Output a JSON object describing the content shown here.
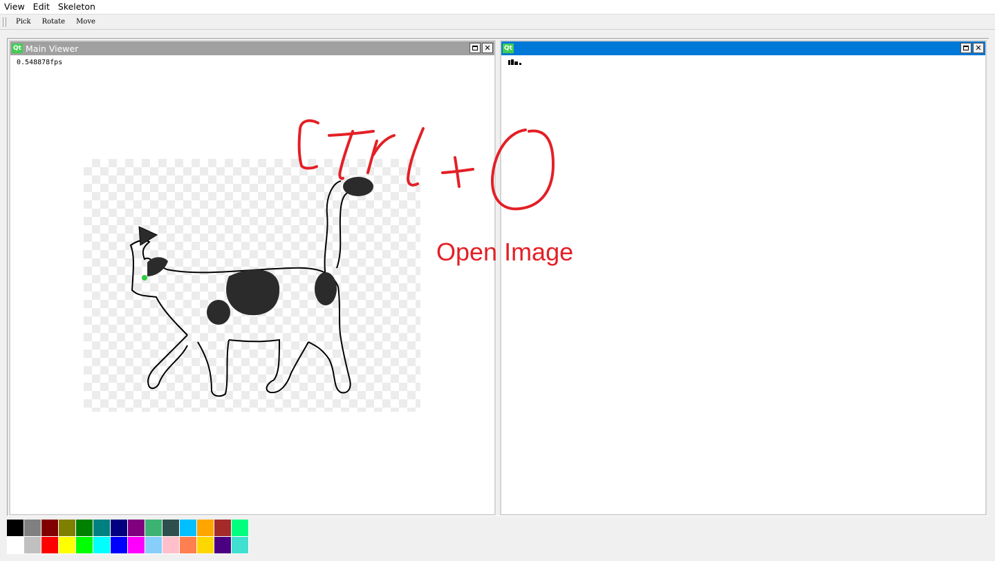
{
  "menubar": {
    "items": [
      "View",
      "Edit",
      "Skeleton"
    ]
  },
  "toolbar": {
    "items": [
      "Pick",
      "Rotate",
      "Move"
    ]
  },
  "windows": {
    "main": {
      "title": "Main Viewer",
      "icon": "Qt",
      "fps": "0.548878fps"
    },
    "second": {
      "title": "",
      "icon": "Qt"
    }
  },
  "annotation": {
    "handwritten": "Ctrl+O",
    "caption": "Open Image",
    "color": "#e32026"
  },
  "palette": {
    "row1": [
      "#000000",
      "#808080",
      "#800000",
      "#808000",
      "#008000",
      "#008080",
      "#000080",
      "#800080",
      "#3cb371",
      "#2f4f4f",
      "#00bfff",
      "#ffa500",
      "#a52a2a",
      "#00ff7f"
    ],
    "row2": [
      "#ffffff",
      "#c0c0c0",
      "#ff0000",
      "#ffff00",
      "#00ff00",
      "#00ffff",
      "#0000ff",
      "#ff00ff",
      "#87cefa",
      "#ffc0cb",
      "#ff7f50",
      "#ffd700",
      "#4b0082",
      "#40e0d0"
    ]
  },
  "accent": {
    "active_title": "#0078d7",
    "inactive_title": "#a0a0a0",
    "qt_green": "#41cd52"
  }
}
